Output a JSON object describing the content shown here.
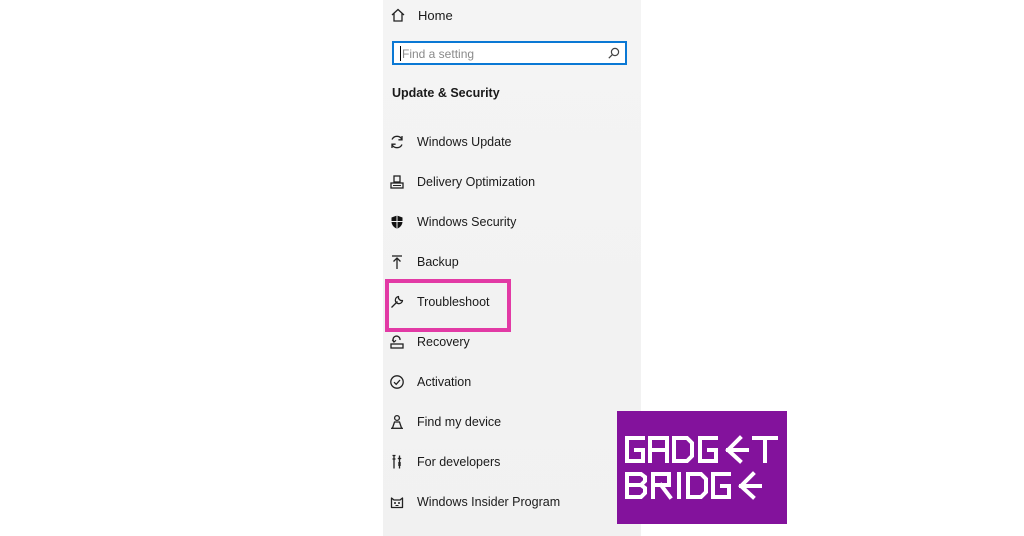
{
  "sidebar": {
    "home_label": "Home",
    "search_placeholder": "Find a setting",
    "section_title": "Update & Security",
    "items": [
      {
        "label": "Windows Update",
        "icon": "sync-icon"
      },
      {
        "label": "Delivery Optimization",
        "icon": "delivery-optimization-icon"
      },
      {
        "label": "Windows Security",
        "icon": "shield-icon"
      },
      {
        "label": "Backup",
        "icon": "backup-upload-icon"
      },
      {
        "label": "Troubleshoot",
        "icon": "wrench-icon"
      },
      {
        "label": "Recovery",
        "icon": "recovery-icon"
      },
      {
        "label": "Activation",
        "icon": "check-circle-icon"
      },
      {
        "label": "Find my device",
        "icon": "person-location-icon"
      },
      {
        "label": "For developers",
        "icon": "developer-tools-icon"
      },
      {
        "label": "Windows Insider Program",
        "icon": "insider-cat-icon"
      }
    ]
  },
  "highlight": {
    "target": "Troubleshoot",
    "color": "#e23aa5"
  },
  "logo": {
    "text_line1": "GADGET",
    "text_line2": "BRIDGE",
    "background": "#83129c"
  },
  "colors": {
    "accent": "#0a78d4",
    "panel_bg": "#f2f2f2"
  }
}
